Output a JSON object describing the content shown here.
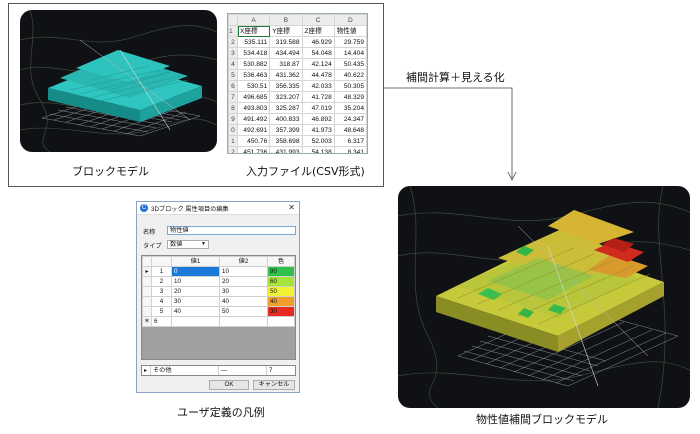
{
  "annotation": "補間計算＋見える化",
  "captions": {
    "block_model": "ブロックモデル",
    "input_file": "入力ファイル(CSV形式)",
    "user_legend": "ユーザ定義の凡例",
    "interp_model": "物性値補間ブロックモデル"
  },
  "csv": {
    "columns": [
      "A",
      "B",
      "C",
      "D"
    ],
    "headers": [
      "X座標",
      "Y座標",
      "Z座標",
      "物性値"
    ],
    "rows": [
      [
        "535.111",
        "319.588",
        "46.929",
        "29.759"
      ],
      [
        "534.418",
        "434.494",
        "54.048",
        "14.404"
      ],
      [
        "530.882",
        "318.87",
        "42.124",
        "50.435"
      ],
      [
        "536.463",
        "431.362",
        "44.478",
        "40.622"
      ],
      [
        "530.51",
        "356.335",
        "42.033",
        "50.305"
      ],
      [
        "496.685",
        "323.207",
        "41.728",
        "48.329"
      ],
      [
        "493.803",
        "325.287",
        "47.019",
        "35.204"
      ],
      [
        "491.492",
        "400.833",
        "46.892",
        "24.347"
      ],
      [
        "492.691",
        "357.399",
        "41.973",
        "48.648"
      ],
      [
        "450.76",
        "358.698",
        "52.003",
        "6.317"
      ],
      [
        "451.736",
        "431.993",
        "54.138",
        "8.341"
      ]
    ],
    "row_numbers": [
      "1",
      "2",
      "3",
      "4",
      "5",
      "6",
      "7",
      "8",
      "9",
      "0",
      "1",
      "2"
    ]
  },
  "dialog": {
    "title": "3Dブロック 属性項目の編集",
    "close": "✕",
    "name_label": "名称",
    "name_value": "物性値",
    "type_label": "タイプ",
    "type_value": "数値",
    "legend_headers": [
      "値1",
      "値2",
      "色"
    ],
    "legend_rows": [
      {
        "n": "1",
        "v1": "0",
        "v2": "10",
        "color_label": "90",
        "color": "#2ec24a"
      },
      {
        "n": "2",
        "v1": "10",
        "v2": "20",
        "color_label": "60",
        "color": "#a6e43c"
      },
      {
        "n": "3",
        "v1": "20",
        "v2": "30",
        "color_label": "50",
        "color": "#f2f235"
      },
      {
        "n": "4",
        "v1": "30",
        "v2": "40",
        "color_label": "40",
        "color": "#f0a02a"
      },
      {
        "n": "5",
        "v1": "40",
        "v2": "50",
        "color_label": "30",
        "color": "#e82b20"
      }
    ],
    "new_row_mark": "＊",
    "new_row_n": "6",
    "other_label": "その他",
    "other_v2": "—",
    "other_color": "7",
    "ok_label": "OK",
    "cancel_label": "キャンセル"
  },
  "colors": {
    "block_cyan": "#28b4b0",
    "panel_bg": "#0f1114"
  }
}
